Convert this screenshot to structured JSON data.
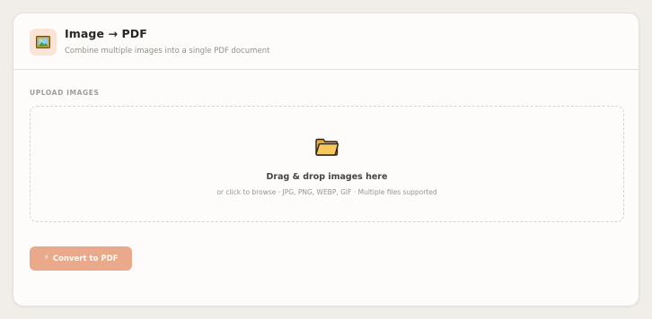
{
  "tool": {
    "title": "Image → PDF",
    "subtitle": "Combine multiple images into a single PDF document",
    "icon": "image-picture-icon"
  },
  "upload": {
    "section_label": "UPLOAD IMAGES",
    "dropzone_title": "Drag & drop images here",
    "dropzone_hint": "or click to browse · JPG, PNG, WEBP, GIF · Multiple files supported",
    "icon": "folder-icon"
  },
  "actions": {
    "convert_label": "Convert to PDF",
    "convert_icon": "lightning-bolt-icon",
    "convert_color": "#eaa98a"
  },
  "colors": {
    "accent": "#eaa98a",
    "icon_bg": "#fbe3d6",
    "background": "#f1eeea",
    "card": "#fdfcfb"
  }
}
